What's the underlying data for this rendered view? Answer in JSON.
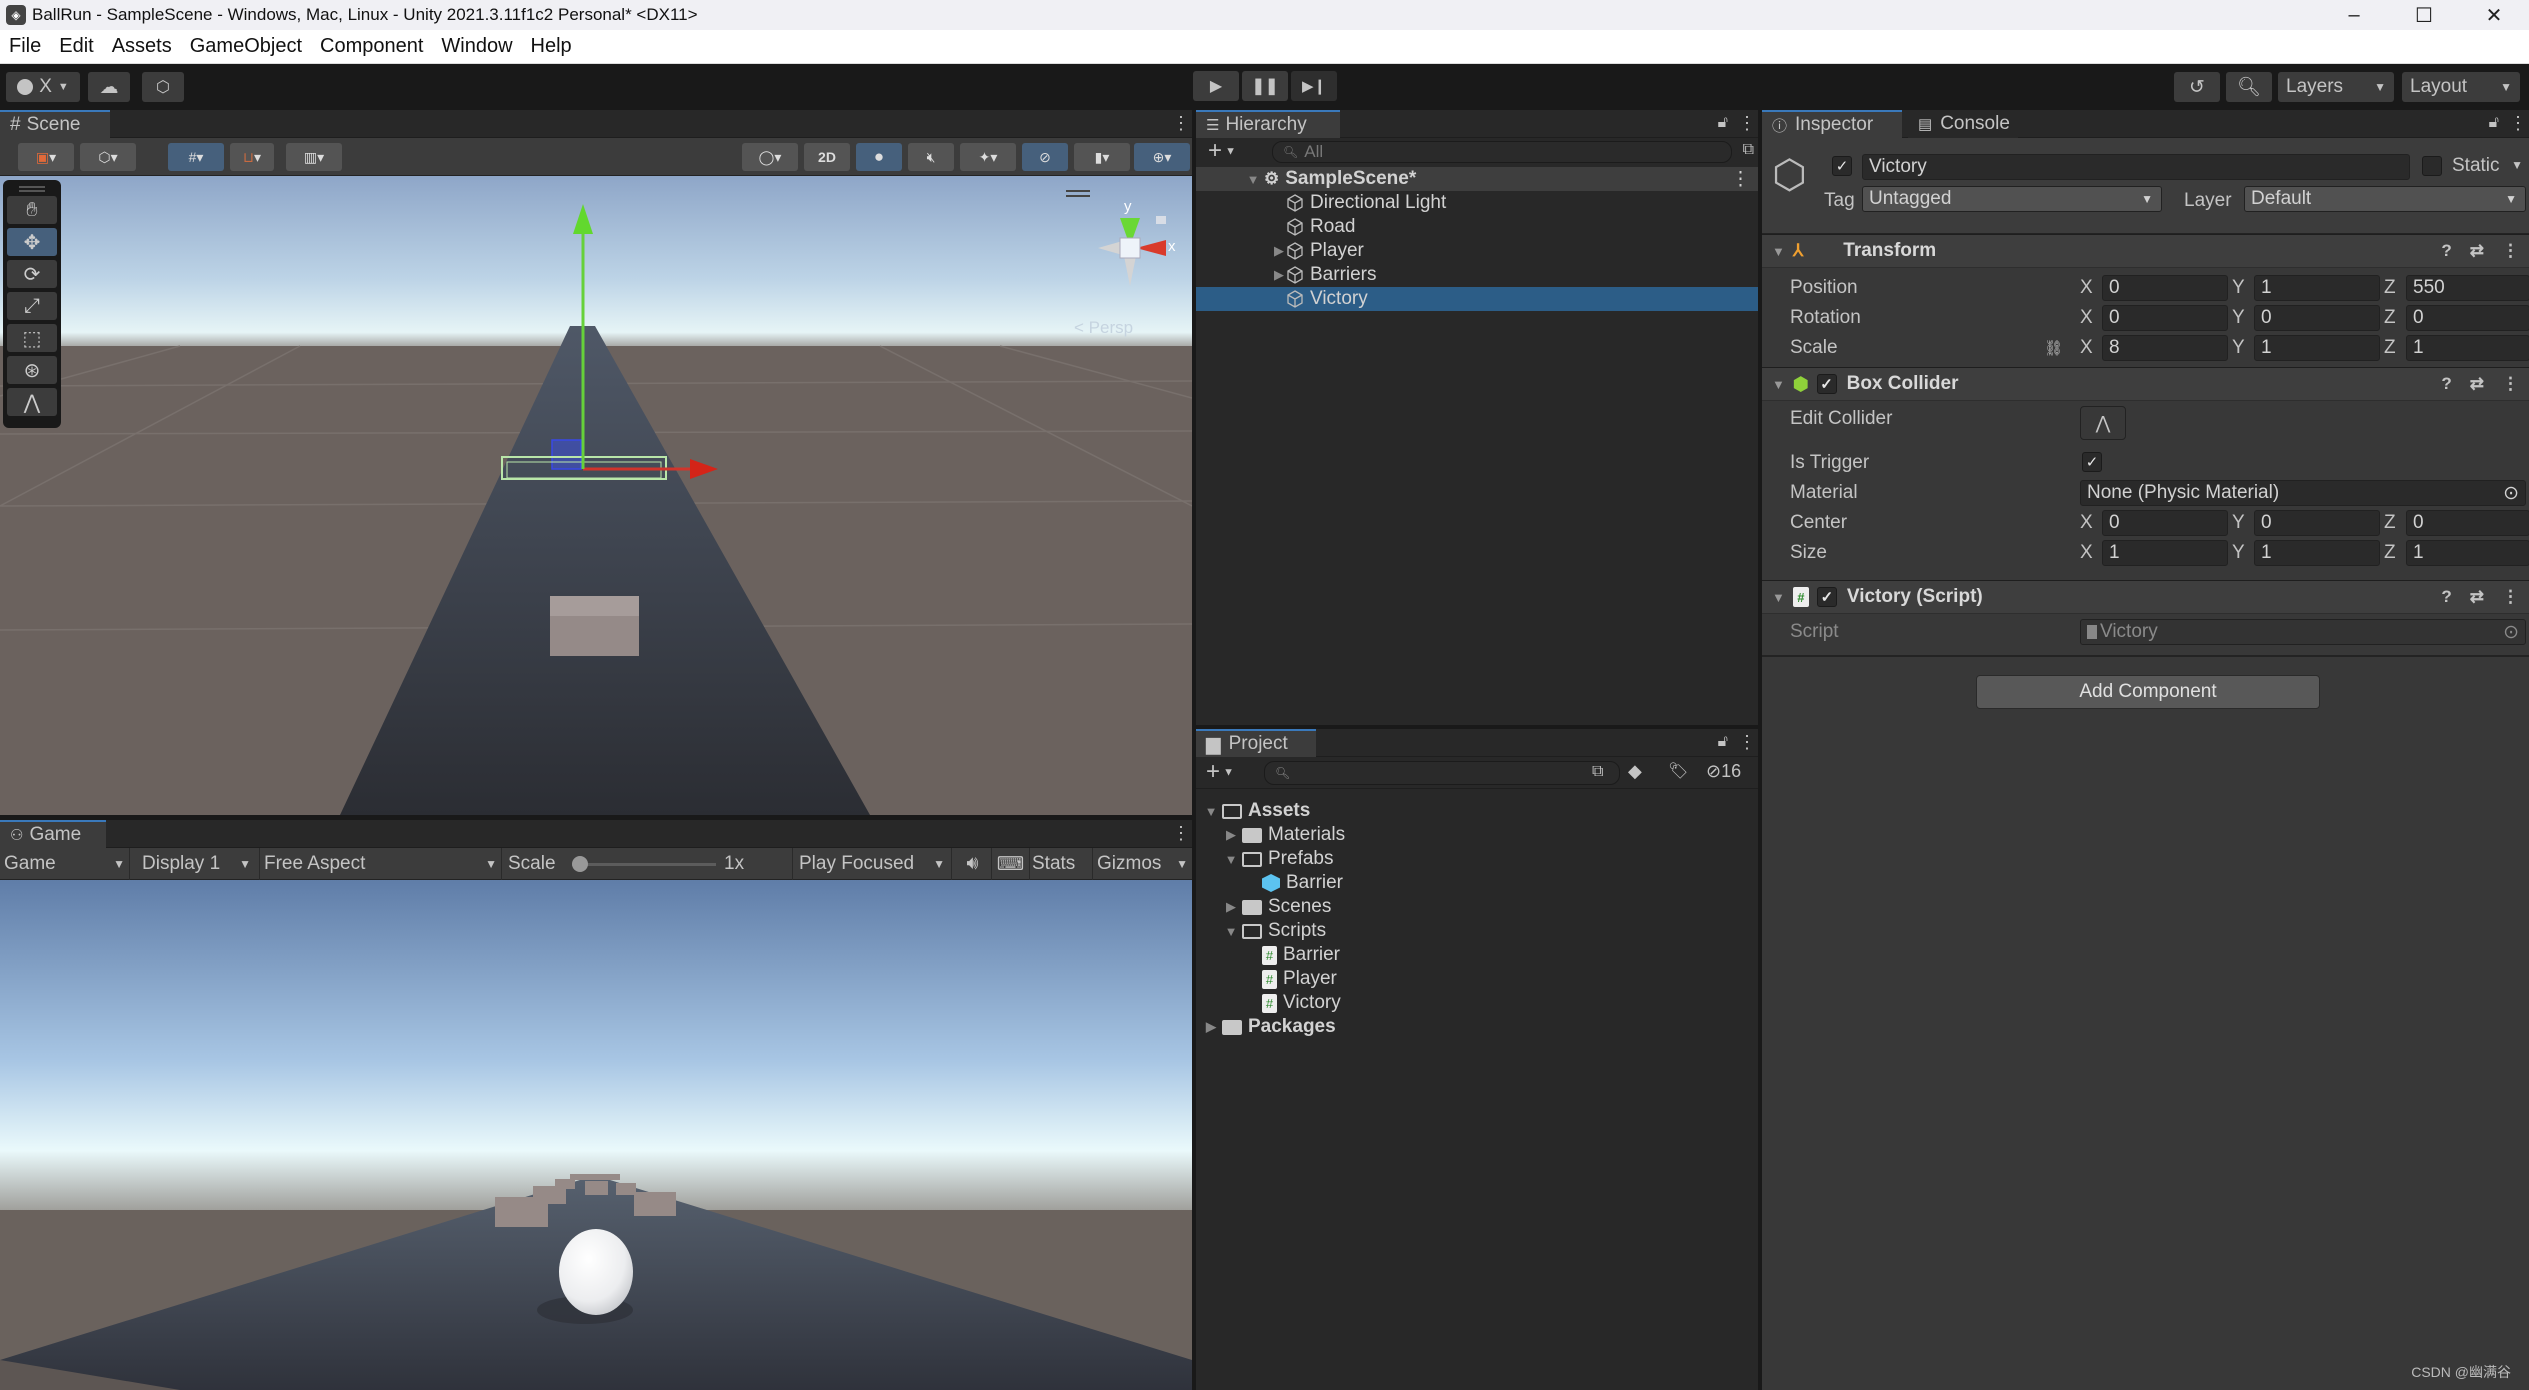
{
  "window": {
    "title": "BallRun - SampleScene - Windows, Mac, Linux - Unity 2021.3.11f1c2 Personal* <DX11>",
    "minimize": "–",
    "maximize": "☐",
    "close": "✕"
  },
  "menu": [
    "File",
    "Edit",
    "Assets",
    "GameObject",
    "Component",
    "Window",
    "Help"
  ],
  "toolbar": {
    "account_label": "X",
    "layers_label": "Layers",
    "layout_label": "Layout"
  },
  "scene": {
    "tab_label": "Scene",
    "toggle_2d": "2D",
    "gizmo_persp": "Persp",
    "axis_x": "x",
    "axis_y": "y"
  },
  "game": {
    "tab_label": "Game",
    "view_select": "Game",
    "display_select": "Display 1",
    "aspect_select": "Free Aspect",
    "scale_label": "Scale",
    "scale_value": "1x",
    "scale_fraction": 0,
    "play_mode_select": "Play Focused",
    "stats_label": "Stats",
    "gizmos_label": "Gizmos"
  },
  "hierarchy": {
    "tab_label": "Hierarchy",
    "search_placeholder": "All",
    "scene_name": "SampleScene*",
    "items": [
      {
        "label": "Directional Light",
        "expandable": false,
        "selected": false
      },
      {
        "label": "Road",
        "expandable": false,
        "selected": false
      },
      {
        "label": "Player",
        "expandable": true,
        "selected": false
      },
      {
        "label": "Barriers",
        "expandable": true,
        "selected": false
      },
      {
        "label": "Victory",
        "expandable": false,
        "selected": true
      }
    ]
  },
  "project": {
    "tab_label": "Project",
    "search_placeholder": "",
    "hidden_count": "16",
    "tree": [
      {
        "label": "Assets",
        "depth": 0,
        "type": "folder-open",
        "expanded": true,
        "bold": true
      },
      {
        "label": "Materials",
        "depth": 1,
        "type": "folder",
        "expanded": false
      },
      {
        "label": "Prefabs",
        "depth": 1,
        "type": "folder-open",
        "expanded": true
      },
      {
        "label": "Barrier",
        "depth": 2,
        "type": "prefab"
      },
      {
        "label": "Scenes",
        "depth": 1,
        "type": "folder",
        "expanded": false
      },
      {
        "label": "Scripts",
        "depth": 1,
        "type": "folder-open",
        "expanded": true
      },
      {
        "label": "Barrier",
        "depth": 2,
        "type": "script"
      },
      {
        "label": "Player",
        "depth": 2,
        "type": "script"
      },
      {
        "label": "Victory",
        "depth": 2,
        "type": "script"
      },
      {
        "label": "Packages",
        "depth": 0,
        "type": "folder",
        "expanded": false,
        "bold": true
      }
    ]
  },
  "inspector": {
    "tab_label": "Inspector",
    "console_tab_label": "Console",
    "object_name": "Victory",
    "active": true,
    "static_label": "Static",
    "static_checked": false,
    "tag_label": "Tag",
    "tag_value": "Untagged",
    "layer_label": "Layer",
    "layer_value": "Default",
    "transform": {
      "title": "Transform",
      "position_label": "Position",
      "rotation_label": "Rotation",
      "scale_label": "Scale",
      "position": {
        "x": "0",
        "y": "1",
        "z": "550"
      },
      "rotation": {
        "x": "0",
        "y": "0",
        "z": "0"
      },
      "scale": {
        "x": "8",
        "y": "1",
        "z": "1"
      }
    },
    "box_collider": {
      "title": "Box Collider",
      "enabled": true,
      "edit_collider_label": "Edit Collider",
      "is_trigger_label": "Is Trigger",
      "is_trigger": true,
      "material_label": "Material",
      "material_value": "None (Physic Material)",
      "center_label": "Center",
      "size_label": "Size",
      "center": {
        "x": "0",
        "y": "0",
        "z": "0"
      },
      "size": {
        "x": "1",
        "y": "1",
        "z": "1"
      }
    },
    "script_component": {
      "title": "Victory (Script)",
      "enabled": true,
      "script_label": "Script",
      "script_value": "Victory"
    },
    "add_component_label": "Add Component",
    "axis_labels": {
      "x": "X",
      "y": "Y",
      "z": "Z"
    }
  },
  "watermark": "CSDN @幽满谷",
  "colors": {
    "selection": "#2c5d87",
    "active_toggle": "#46607c",
    "axis_x": "#d93a2b",
    "axis_y": "#6ad835"
  }
}
